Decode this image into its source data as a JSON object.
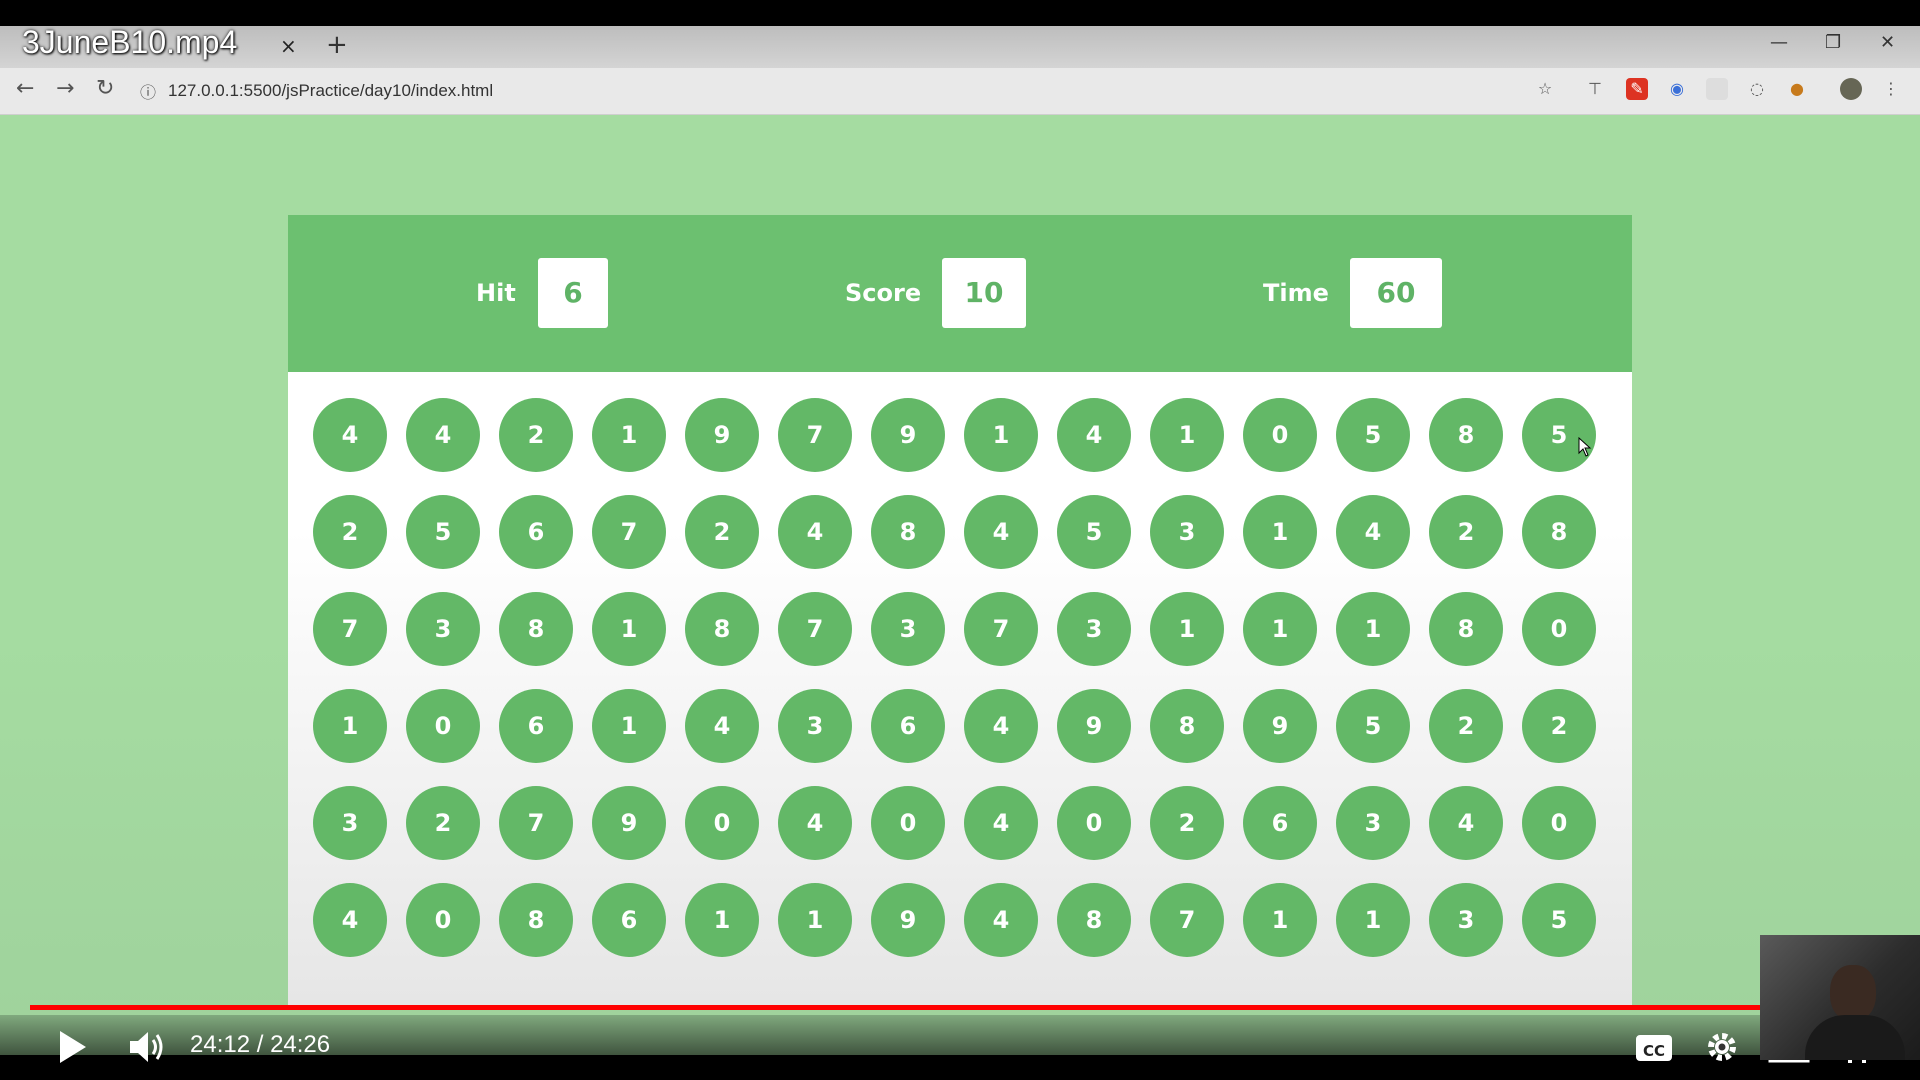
{
  "browser": {
    "tab_title": "3JuneB10.mp4",
    "tab_close": "×",
    "new_tab": "+",
    "url": "127.0.0.1:5500/jsPractice/day10/index.html"
  },
  "game": {
    "stats": [
      {
        "label": "Hit",
        "value": "6"
      },
      {
        "label": "Score",
        "value": "10"
      },
      {
        "label": "Time",
        "value": "60"
      }
    ],
    "bubbles": [
      [
        "4",
        "4",
        "2",
        "1",
        "9",
        "7",
        "9",
        "1",
        "4",
        "1",
        "0",
        "5",
        "8",
        "5"
      ],
      [
        "2",
        "5",
        "6",
        "7",
        "2",
        "4",
        "8",
        "4",
        "5",
        "3",
        "1",
        "4",
        "2",
        "8"
      ],
      [
        "7",
        "3",
        "8",
        "1",
        "8",
        "7",
        "3",
        "7",
        "3",
        "1",
        "1",
        "1",
        "8",
        "0"
      ],
      [
        "1",
        "0",
        "6",
        "1",
        "4",
        "3",
        "6",
        "4",
        "9",
        "8",
        "9",
        "5",
        "2",
        "2"
      ],
      [
        "3",
        "2",
        "7",
        "9",
        "0",
        "4",
        "0",
        "4",
        "0",
        "2",
        "6",
        "3",
        "4",
        "0"
      ],
      [
        "4",
        "0",
        "8",
        "6",
        "1",
        "1",
        "9",
        "4",
        "8",
        "7",
        "1",
        "1",
        "3",
        "5"
      ]
    ],
    "colors": {
      "header": "#6cc070",
      "bubble": "#63b867",
      "background": "#a5dca1"
    }
  },
  "player": {
    "time_display": "24:12 / 24:26",
    "cc_label": "CC",
    "progress_fraction": 0.99,
    "icons": [
      "play-icon",
      "volume-icon",
      "cc-icon",
      "settings-icon",
      "miniplayer-icon",
      "exit-fullscreen-icon"
    ]
  }
}
